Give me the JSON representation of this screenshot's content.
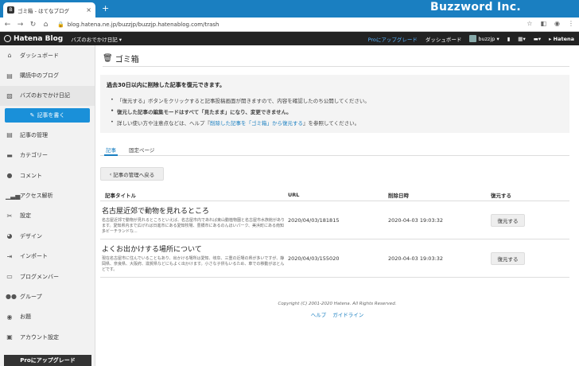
{
  "browser": {
    "tab_title": "ゴミ箱 - はてなブログ",
    "favicon_text": "B",
    "url": "blog.hatena.ne.jp/buzzjp/buzzjp.hatenablog.com/trash",
    "window_brand": "Buzzword Inc."
  },
  "topnav": {
    "logo": "Hatena Blog",
    "blog_selector": "バズのおでかけ日記 ▾",
    "pro_link": "Proにアップグレード",
    "dashboard": "ダッシュボード",
    "user": "buzzjp ▾",
    "hatena": "Hatena"
  },
  "sidebar": {
    "items": [
      {
        "label": "ダッシュボード",
        "icon": "home-icon"
      },
      {
        "label": "購読中のブログ",
        "icon": "book-icon"
      },
      {
        "label": "バズのおでかけ日記",
        "icon": "blog-icon"
      }
    ],
    "write_button": "記事を書く",
    "menu": [
      {
        "label": "記事の管理"
      },
      {
        "label": "カテゴリー"
      },
      {
        "label": "コメント"
      },
      {
        "label": "アクセス解析"
      },
      {
        "label": "設定"
      },
      {
        "label": "デザイン"
      },
      {
        "label": "インポート"
      },
      {
        "label": "ブログメンバー"
      },
      {
        "label": "グループ"
      },
      {
        "label": "お題"
      },
      {
        "label": "アカウント設定"
      }
    ],
    "pro_upgrade": "Proにアップグレード"
  },
  "main": {
    "title": "ゴミ箱",
    "notice": {
      "heading": "過去30日以内に削除した記事を復元できます。",
      "items": [
        "「復元する」ボタンをクリックすると記事投稿画面が開きますので、内容を確認したのち公開してください。",
        "復元した記事の編集モードはすべて「見たまま」になり、変更できません。"
      ],
      "help_prefix": "詳しい使い方や注意点などは、ヘルプ『",
      "help_link": "削除した記事を「ゴミ箱」から復元する",
      "help_suffix": "』を参照してください。"
    },
    "tabs": [
      "記事",
      "固定ページ"
    ],
    "back_button": "記事の管理へ戻る",
    "table": {
      "headers": [
        "記事タイトル",
        "URL",
        "削除日時",
        "復元する"
      ],
      "rows": [
        {
          "title": "名古屋近郊で動物を見れるところ",
          "excerpt": "名古屋近郊で動物が見れるところといえば、名古屋市内であれば東山動植物園と名古屋市水族館があります。愛知県内まで広げれば日進市にある愛知牧場、豊橋市にあるのんほいパーク、美浜町にある南知多ビーチランドな...",
          "url": "2020/04/03/181815",
          "deleted_at": "2020-04-03 19:03:32",
          "button": "復元する"
        },
        {
          "title": "よくお出かけする場所について",
          "excerpt": "現在名古屋市に住んでいることもあり、出かける場所は愛知、岐阜、三重の近場の県が多いですが、静岡県、奈良県、大阪府、滋賀県などにもよく出かけます。小さな子供もいるため、車での移動がほとんどです。",
          "url": "2020/04/03/155020",
          "deleted_at": "2020-04-03 19:03:32",
          "button": "復元する"
        }
      ]
    },
    "footer": {
      "copyright": "Copyright (C) 2001-2020 Hatena. All Rights Reserved.",
      "links": [
        "ヘルプ",
        "ガイドライン"
      ]
    }
  }
}
